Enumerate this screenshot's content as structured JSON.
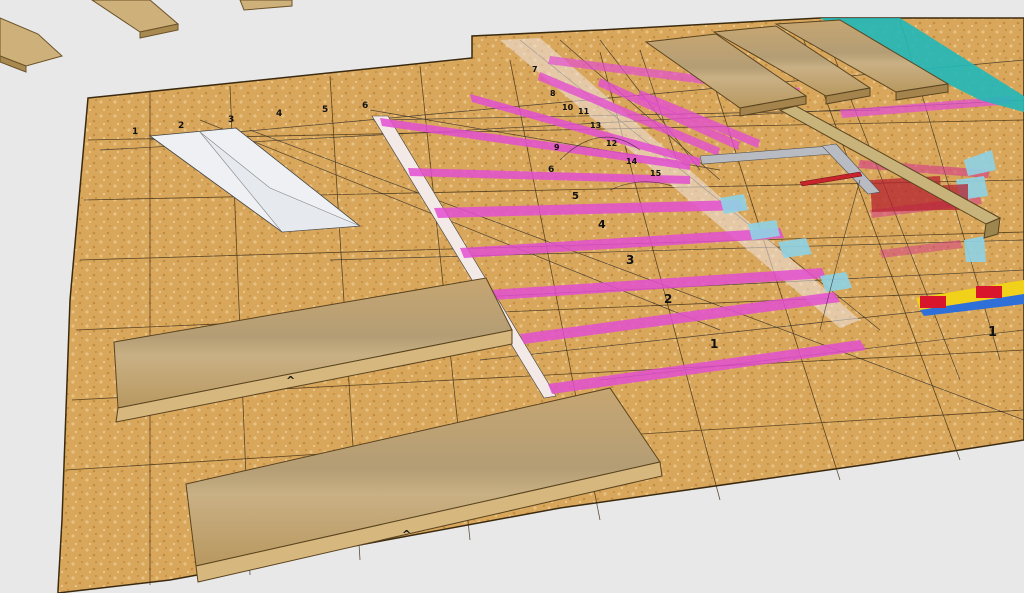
{
  "scene": {
    "background_color": "#e8e8e8",
    "osb_color": "#d9a75c",
    "board_color": "#c9ad78",
    "magenta": "#e24fd0",
    "pink": "#f29bd6",
    "light_blue": "#8fd3e6",
    "teal": "#20b8b8",
    "red": "#d8152a",
    "yellow": "#f2d11a",
    "blue": "#2f6fd8"
  },
  "labels": {
    "step_numbers": [
      "1",
      "2",
      "3",
      "4",
      "5",
      "6",
      "7",
      "8",
      "9",
      "10",
      "11",
      "12",
      "13",
      "14",
      "15"
    ],
    "top_ruler": [
      "1",
      "2",
      "3",
      "4",
      "5",
      "6"
    ],
    "board_marks": [
      "^",
      "^"
    ],
    "right_number": "1"
  }
}
